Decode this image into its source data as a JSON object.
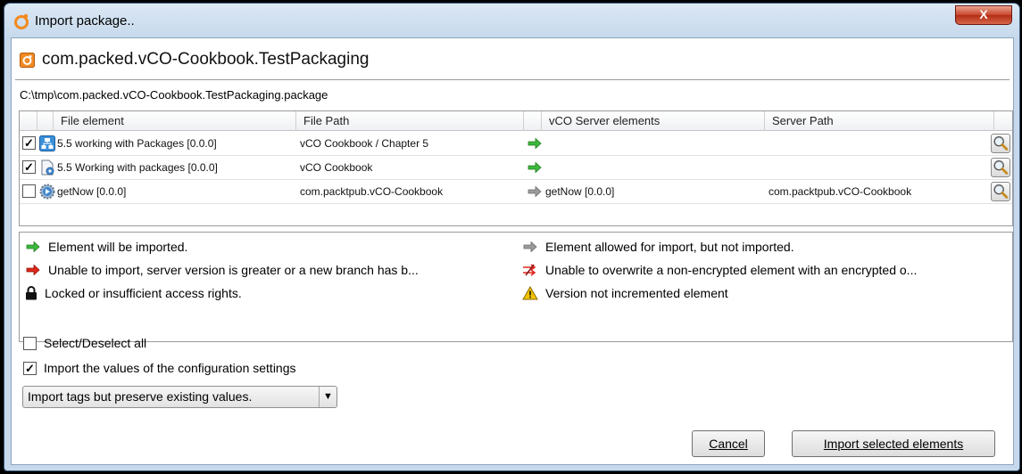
{
  "window": {
    "title": "Import package..",
    "close_label": "X"
  },
  "package": {
    "name": "com.packed.vCO-Cookbook.TestPackaging",
    "path": "C:\\tmp\\com.packed.vCO-Cookbook.TestPackaging.package"
  },
  "table": {
    "columns": [
      "File element",
      "File Path",
      "vCO Server elements",
      "Server Path"
    ],
    "rows": [
      {
        "checked": true,
        "icon": "workflow-icon",
        "file_element": "5.5 working with Packages [0.0.0]",
        "file_path": "vCO Cookbook / Chapter 5",
        "arrow": "green",
        "server_element": "",
        "server_path": ""
      },
      {
        "checked": true,
        "icon": "action-icon",
        "file_element": "5.5 Working with packages [0.0.0]",
        "file_path": "vCO Cookbook",
        "arrow": "green",
        "server_element": "",
        "server_path": ""
      },
      {
        "checked": false,
        "icon": "gear-action-icon",
        "file_element": "getNow [0.0.0]",
        "file_path": "com.packtpub.vCO-Cookbook",
        "arrow": "gray",
        "server_element": "getNow [0.0.0]",
        "server_path": "com.packtpub.vCO-Cookbook"
      }
    ]
  },
  "legend": {
    "imported": "Element will be imported.",
    "allowed_not_imported": "Element allowed for import, but not imported.",
    "unable_import": "Unable to import, server version is greater or a new branch has b...",
    "unable_overwrite": "Unable to overwrite a non-encrypted element with an encrypted o...",
    "locked": "Locked or insufficient access rights.",
    "not_incremented": "Version not incremented element"
  },
  "options": {
    "select_all_label": "Select/Deselect all",
    "select_all_checked": false,
    "import_config_label": "Import the values of the configuration settings",
    "import_config_checked": true,
    "tags_select_value": "Import tags but preserve existing values."
  },
  "buttons": {
    "cancel": "Cancel",
    "import_selected": "Import selected elements"
  },
  "colors": {
    "green_arrow": "#3cb83c",
    "red_arrow": "#e0261a",
    "gray_arrow": "#9a9a9a",
    "warning": "#f2c200"
  }
}
